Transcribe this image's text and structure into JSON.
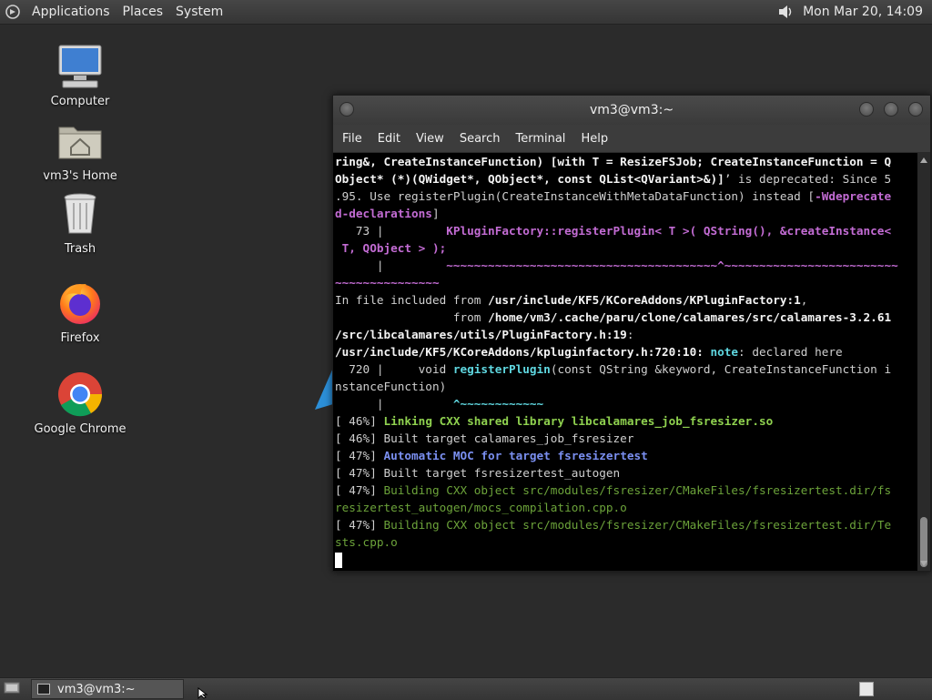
{
  "top_panel": {
    "menus": [
      "Applications",
      "Places",
      "System"
    ],
    "clock": "Mon Mar 20, 14:09",
    "icons": [
      "gnome-foot-icon",
      "speaker-icon"
    ]
  },
  "desktop": {
    "icons": [
      {
        "label": "Computer",
        "icon": "computer-icon"
      },
      {
        "label": "vm3's Home",
        "icon": "home-folder-icon"
      },
      {
        "label": "Trash",
        "icon": "trash-icon"
      },
      {
        "label": "Firefox",
        "icon": "firefox-icon"
      },
      {
        "label": "Google Chrome",
        "icon": "chrome-icon"
      }
    ]
  },
  "window": {
    "title": "vm3@vm3:~",
    "menus": [
      "File",
      "Edit",
      "View",
      "Search",
      "Terminal",
      "Help"
    ],
    "lines": [
      [
        {
          "t": "ring&, CreateInstanceFunction) [with T = ResizeFSJob; CreateInstanceFunction = Q",
          "c": "bold"
        }
      ],
      [
        {
          "t": "Object* (*)(QWidget*, QObject*, const QList<QVariant>&)]",
          "c": "bold"
        },
        {
          "t": "’ is deprecated: Since 5",
          "c": "dim"
        }
      ],
      [
        {
          "t": ".95. Use registerPlugin(CreateInstanceWithMetaDataFunction) instead [",
          "c": "dim"
        },
        {
          "t": "-Wdeprecate",
          "c": "mag"
        }
      ],
      [
        {
          "t": "d-declarations",
          "c": "mag"
        },
        {
          "t": "]",
          "c": "dim"
        }
      ],
      [
        {
          "t": "   73 |         ",
          "c": "dim"
        },
        {
          "t": "KPluginFactory::registerPlugin< T >( QString(), &createInstance<",
          "c": "mag"
        }
      ],
      [
        {
          "t": " T, QObject > );",
          "c": "mag"
        }
      ],
      [
        {
          "t": "      |         ",
          "c": "dim"
        },
        {
          "t": "~~~~~~~~~~~~~~~~~~~~~~~~~~~~~~~~~~~~~~~^~~~~~~~~~~~~~~~~~~~~~~~~~",
          "c": "mag"
        }
      ],
      [
        {
          "t": "~~~~~~~~~~~~~~~",
          "c": "mag"
        }
      ],
      [
        {
          "t": "In file included from ",
          "c": "dim"
        },
        {
          "t": "/usr/include/KF5/KCoreAddons/KPluginFactory:1",
          "c": "bold"
        },
        {
          "t": ",",
          "c": "dim"
        }
      ],
      [
        {
          "t": "                 from ",
          "c": "dim"
        },
        {
          "t": "/home/vm3/.cache/paru/clone/calamares/src/calamares-3.2.61",
          "c": "bold"
        }
      ],
      [
        {
          "t": "/src/libcalamares/utils/PluginFactory.h:19",
          "c": "bold"
        },
        {
          "t": ":",
          "c": "dim"
        }
      ],
      [
        {
          "t": "/usr/include/KF5/KCoreAddons/kpluginfactory.h:720:10:",
          "c": "bold"
        },
        {
          "t": " ",
          "c": "dim"
        },
        {
          "t": "note",
          "c": "cyan"
        },
        {
          "t": ": declared here",
          "c": "dim"
        }
      ],
      [
        {
          "t": "  720 |     void ",
          "c": "dim"
        },
        {
          "t": "registerPlugin",
          "c": "cyan"
        },
        {
          "t": "(const QString &keyword, CreateInstanceFunction i",
          "c": "dim"
        }
      ],
      [
        {
          "t": "nstanceFunction)",
          "c": "dim"
        }
      ],
      [
        {
          "t": "      |          ",
          "c": "dim"
        },
        {
          "t": "^~~~~~~~~~~~~",
          "c": "cyan"
        }
      ],
      [
        {
          "t": "[ 46%] ",
          "c": "dim"
        },
        {
          "t": "Linking CXX shared library libcalamares_job_fsresizer.so",
          "c": "green"
        }
      ],
      [
        {
          "t": "[ 46%] Built target calamares_job_fsresizer",
          "c": "dim"
        }
      ],
      [
        {
          "t": "[ 47%] ",
          "c": "dim"
        },
        {
          "t": "Automatic MOC for target fsresizertest",
          "c": "blue"
        }
      ],
      [
        {
          "t": "[ 47%] Built target fsresizertest_autogen",
          "c": "dim"
        }
      ],
      [
        {
          "t": "[ 47%] ",
          "c": "dim"
        },
        {
          "t": "Building CXX object src/modules/fsresizer/CMakeFiles/fsresizertest.dir/fs",
          "c": "greenplain"
        }
      ],
      [
        {
          "t": "resizertest_autogen/mocs_compilation.cpp.o",
          "c": "greenplain"
        }
      ],
      [
        {
          "t": "[ 47%] ",
          "c": "dim"
        },
        {
          "t": "Building CXX object src/modules/fsresizer/CMakeFiles/fsresizertest.dir/Te",
          "c": "greenplain"
        }
      ],
      [
        {
          "t": "sts.cpp.o",
          "c": "greenplain"
        }
      ]
    ]
  },
  "bottom_panel": {
    "task_label": "vm3@vm3:~"
  }
}
